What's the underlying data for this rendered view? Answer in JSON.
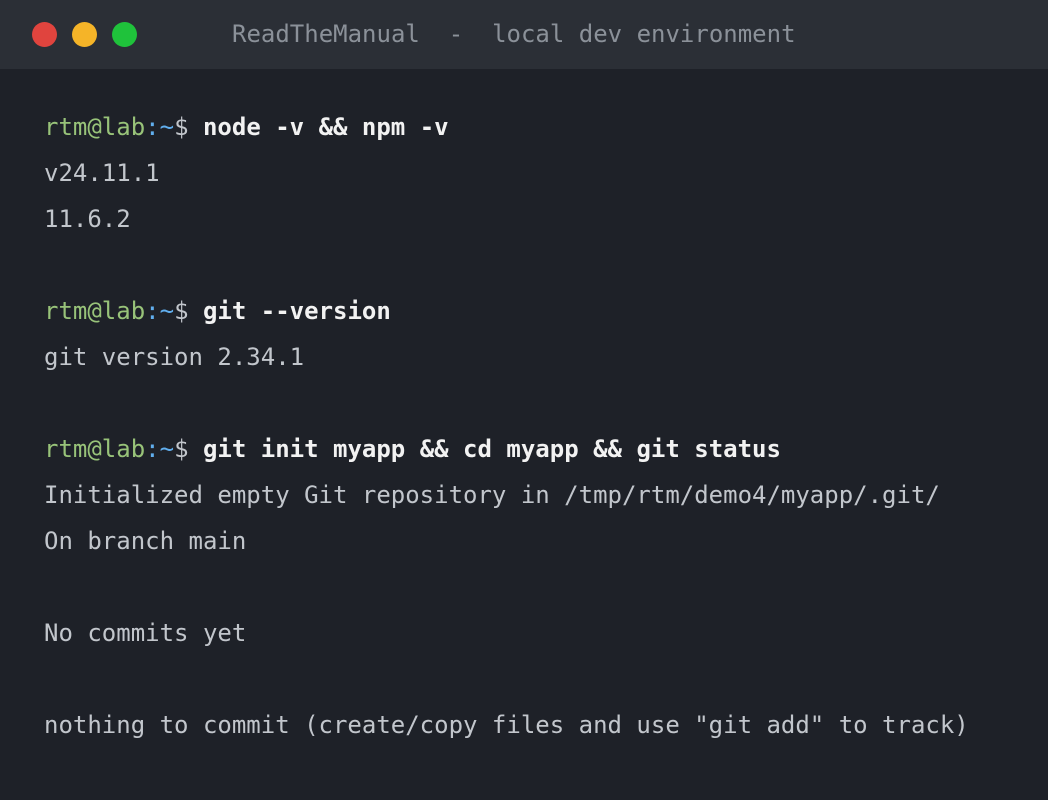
{
  "window": {
    "title": "ReadTheManual  -  local dev environment",
    "controls": {
      "close_color": "#e0443e",
      "minimize_color": "#f5b428",
      "maximize_color": "#1fc23b"
    }
  },
  "terminal": {
    "prompt": {
      "user_host": "rtm@lab",
      "separator": ":",
      "path": "~",
      "symbol": "$ "
    },
    "lines": [
      {
        "type": "command",
        "text": "node -v && npm -v"
      },
      {
        "type": "output",
        "text": "v24.11.1"
      },
      {
        "type": "output",
        "text": "11.6.2"
      },
      {
        "type": "blank",
        "text": ""
      },
      {
        "type": "command",
        "text": "git --version"
      },
      {
        "type": "output",
        "text": "git version 2.34.1"
      },
      {
        "type": "blank",
        "text": ""
      },
      {
        "type": "command",
        "text": "git init myapp && cd myapp && git status"
      },
      {
        "type": "output",
        "text": "Initialized empty Git repository in /tmp/rtm/demo4/myapp/.git/"
      },
      {
        "type": "output",
        "text": "On branch main"
      },
      {
        "type": "blank",
        "text": ""
      },
      {
        "type": "output",
        "text": "No commits yet"
      },
      {
        "type": "blank",
        "text": ""
      },
      {
        "type": "output",
        "text": "nothing to commit (create/copy files and use \"git add\" to track)"
      }
    ]
  }
}
